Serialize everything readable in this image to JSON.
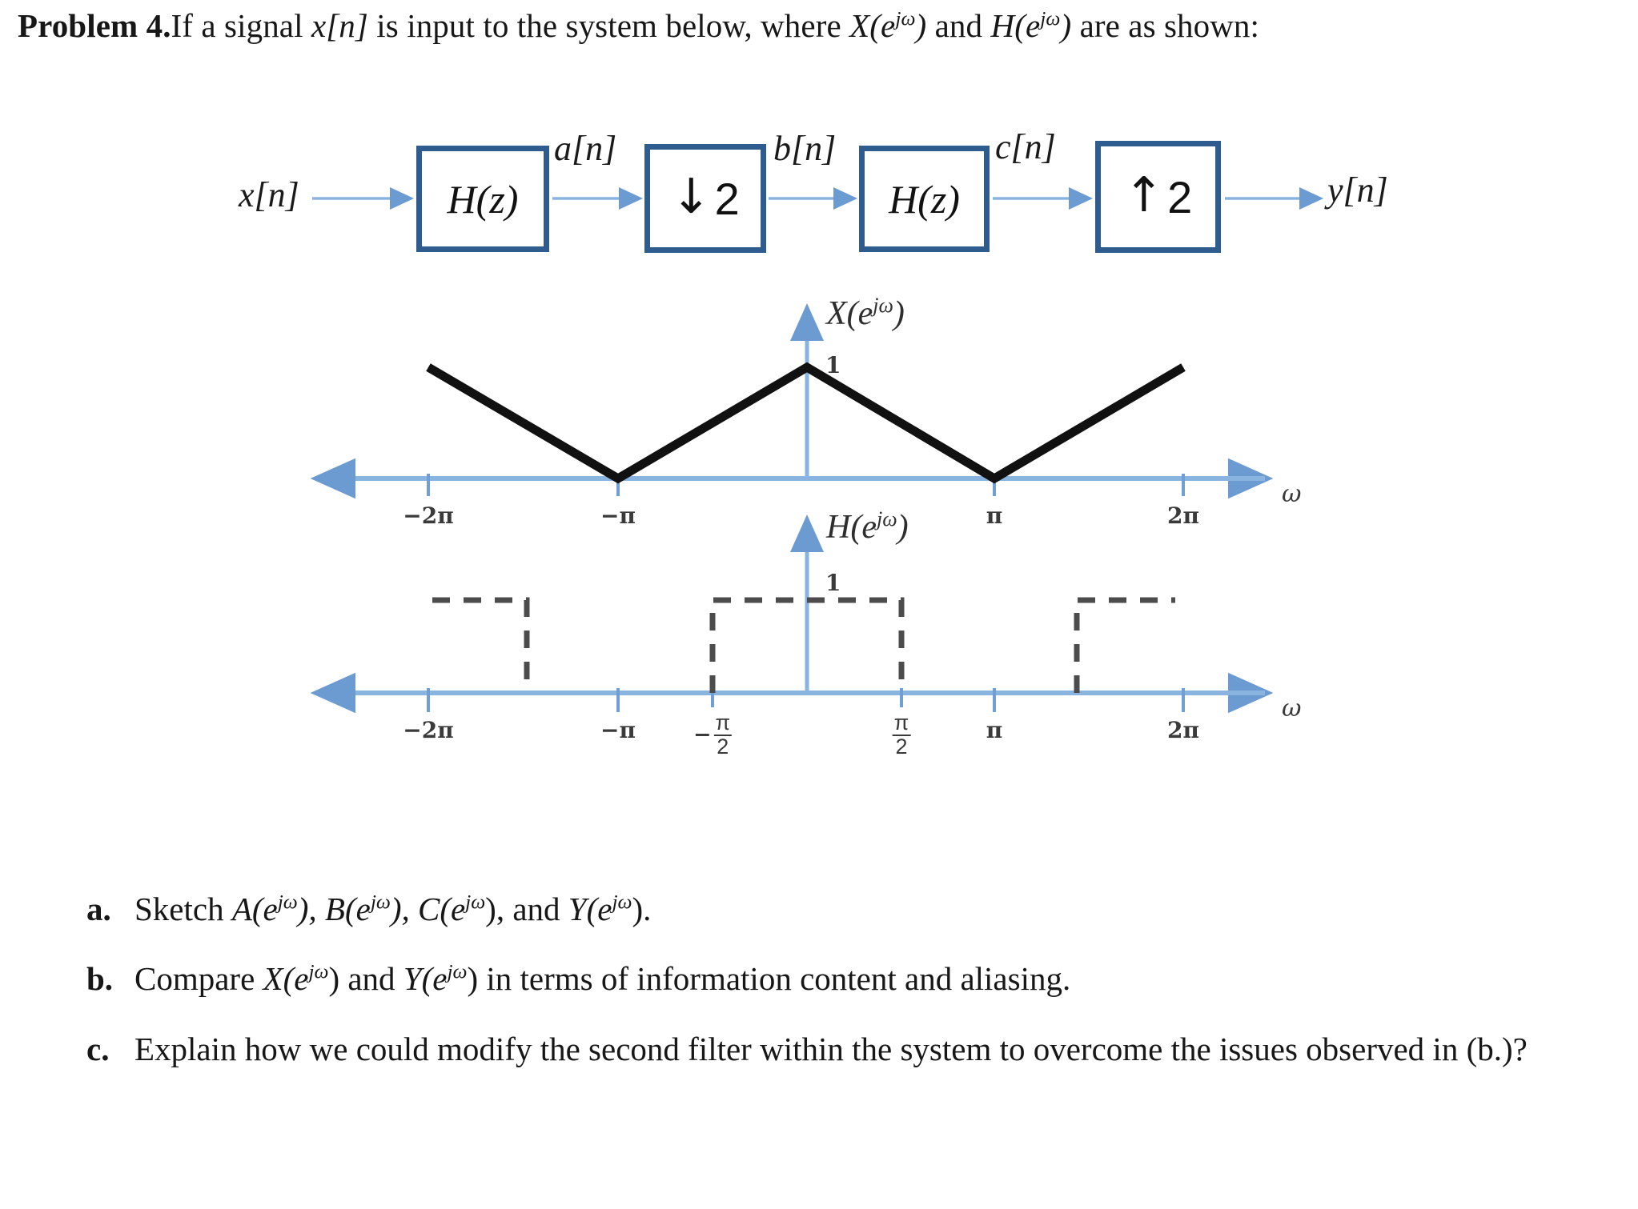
{
  "problem": {
    "label": "Problem 4.",
    "text_part1": "If a signal ",
    "sig_x": "x[n]",
    "text_part2": " is input to the system below, where ",
    "sym_X": "X(e",
    "sym_X_exp": "jω",
    "sym_X_close": ")",
    "text_part3": " and ",
    "sym_H": "H(e",
    "sym_H_exp": "jω",
    "sym_H_close": ")",
    "text_part4": " are as shown:"
  },
  "block_diagram": {
    "input_label": "x[n]",
    "output_label": "y[n]",
    "blocks": [
      {
        "name": "filter-1",
        "label": "H(z)",
        "kind": "filter"
      },
      {
        "name": "downsampler",
        "label": "2",
        "arrow": "↓",
        "kind": "rate"
      },
      {
        "name": "filter-2",
        "label": "H(z)",
        "kind": "filter"
      },
      {
        "name": "upsampler",
        "label": "2",
        "arrow": "↑",
        "kind": "rate"
      }
    ],
    "intermediate_labels": [
      "a[n]",
      "b[n]",
      "c[n]"
    ],
    "accent_color": "#2f5c8f",
    "arrow_color": "#7ba7d7"
  },
  "chart_data": [
    {
      "type": "line",
      "name": "X-spectrum",
      "title": "X(e^{jω})",
      "title_base": "X(e",
      "title_exp": "jω",
      "title_close": ")",
      "xlabel": "ω",
      "ylabel": "",
      "amplitude_label": "1",
      "x_ticks": [
        "−2π",
        "−π",
        "π",
        "2π"
      ],
      "x_tick_values": [
        -6.2832,
        -3.1416,
        3.1416,
        6.2832
      ],
      "xlim": [
        -7.9,
        8.2
      ],
      "ylim": [
        0,
        1.18
      ],
      "grid": false,
      "legend": null,
      "description": "Periodic triangular spectrum, peak value 1 at ω = 0 and ω = ±2π, zero at ω = ±π",
      "x": [
        -6.2832,
        -3.1416,
        0,
        3.1416,
        6.2832
      ],
      "values": [
        1,
        0,
        1,
        0,
        1
      ],
      "line_color": "#111111",
      "axis_color": "#8ab0dd"
    },
    {
      "type": "line",
      "name": "H-spectrum",
      "title": "H(e^{jω})",
      "title_base": "H(e",
      "title_exp": "jω",
      "title_close": ")",
      "xlabel": "ω",
      "ylabel": "",
      "amplitude_label": "1",
      "x_ticks": [
        "−2π",
        "−π",
        "−π/2",
        "π/2",
        "π",
        "2π"
      ],
      "x_tick_values": [
        -6.2832,
        -3.1416,
        -1.5708,
        1.5708,
        3.1416,
        6.2832
      ],
      "xlim": [
        -7.9,
        8.2
      ],
      "ylim": [
        0,
        1.18
      ],
      "grid": false,
      "legend": null,
      "description": "Ideal periodic lowpass filter, magnitude 1 for |ω| < π/2 modulo 2π, dashed outline",
      "x": [
        -7.85,
        -4.712,
        -4.712,
        -1.5708,
        -1.5708,
        1.5708,
        1.5708,
        4.712,
        4.712,
        7.85
      ],
      "values": [
        1,
        1,
        0,
        0,
        1,
        1,
        0,
        0,
        1,
        1
      ],
      "line_color": "#4a4a4a",
      "line_style": "dashed",
      "axis_color": "#8ab0dd"
    }
  ],
  "questions": [
    {
      "label": "a.",
      "text_pre": "Sketch ",
      "text": "Sketch A(ejω), B(ejω), C(ejω), and Y(ejω)."
    },
    {
      "label": "b.",
      "text": "Compare X(ejω) and Y(ejω) in terms of information content and aliasing."
    },
    {
      "label": "c.",
      "text": "Explain how we could modify the second filter within the system to overcome the issues observed in (b.)?"
    }
  ],
  "question_fragments": {
    "a": [
      "Sketch ",
      "A(e",
      "jω",
      "), ",
      "B(e",
      "jω",
      "), ",
      "C(e",
      "jω",
      "), and ",
      "Y(e",
      "jω",
      ")."
    ],
    "b": [
      "Compare ",
      "X(e",
      "jω",
      ") and ",
      "Y(e",
      "jω",
      ") in terms of information content and aliasing."
    ],
    "c": [
      "Explain how we could modify the second filter within the system to overcome the issues observed in (b.)?"
    ]
  }
}
